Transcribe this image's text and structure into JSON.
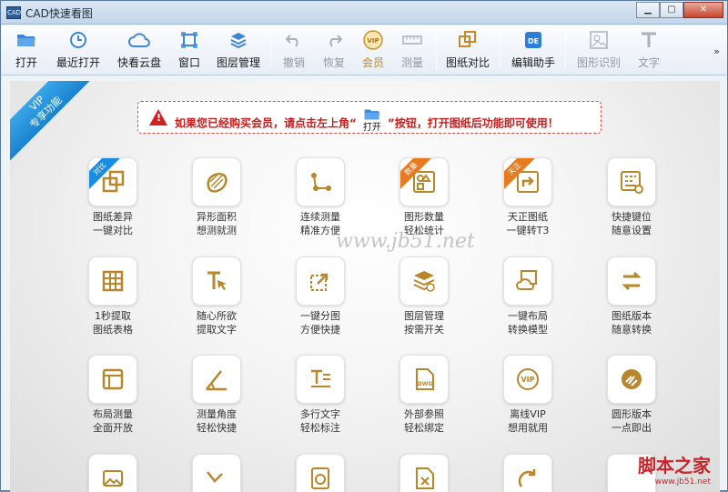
{
  "window": {
    "title": "CAD快速看图",
    "app_icon_text": "CAD",
    "controls": {
      "minimize": "▁",
      "maximize": "▢",
      "close": "✕"
    }
  },
  "toolbar": {
    "items": [
      {
        "label": "打开",
        "icon": "folder-open-icon",
        "enabled": true
      },
      {
        "label": "最近打开",
        "icon": "clock-icon",
        "enabled": true
      },
      {
        "label": "快看云盘",
        "icon": "cloud-icon",
        "enabled": true
      },
      {
        "label": "窗口",
        "icon": "window-icon",
        "enabled": true
      },
      {
        "label": "图层管理",
        "icon": "layers-icon",
        "enabled": true
      },
      {
        "label": "撤销",
        "icon": "undo-icon",
        "enabled": false
      },
      {
        "label": "恢复",
        "icon": "redo-icon",
        "enabled": false
      },
      {
        "label": "会员",
        "icon": "vip-icon",
        "enabled": true
      },
      {
        "label": "测量",
        "icon": "ruler-icon",
        "enabled": false
      },
      {
        "label": "图纸对比",
        "icon": "compare-icon",
        "enabled": true
      },
      {
        "label": "编辑助手",
        "icon": "edit-assistant-icon",
        "enabled": true
      },
      {
        "label": "图形识别",
        "icon": "shape-recognize-icon",
        "enabled": false
      },
      {
        "label": "文字",
        "icon": "text-icon",
        "enabled": false
      }
    ],
    "more": "»"
  },
  "vip_ribbon": {
    "line1": "VIP",
    "line2": "专享功能"
  },
  "notice": {
    "warn_glyph": "!",
    "before": "如果您已经购买会员，请点击左上角“",
    "open_label": "打开",
    "after": "”按钮，打开图纸后功能即可使用！"
  },
  "features": [
    {
      "l1": "图纸差异",
      "l2": "一键对比",
      "icon": "compare-icon",
      "badge": "对比",
      "badge_color": "blue"
    },
    {
      "l1": "异形面积",
      "l2": "想测就测",
      "icon": "irregular-area-icon"
    },
    {
      "l1": "连续测量",
      "l2": "精准方便",
      "icon": "continuous-measure-icon"
    },
    {
      "l1": "图形数量",
      "l2": "轻松统计",
      "icon": "shape-count-icon",
      "badge": "数量",
      "badge_color": "orange"
    },
    {
      "l1": "天正图纸",
      "l2": "一键转T3",
      "icon": "tangent-convert-icon",
      "badge": "天正",
      "badge_color": "orange"
    },
    {
      "l1": "快捷键位",
      "l2": "随意设置",
      "icon": "shortcut-key-icon"
    },
    {
      "l1": "1秒提取",
      "l2": "图纸表格",
      "icon": "table-extract-icon"
    },
    {
      "l1": "随心所欲",
      "l2": "提取文字",
      "icon": "text-extract-icon"
    },
    {
      "l1": "一键分图",
      "l2": "方便快捷",
      "icon": "split-drawing-icon"
    },
    {
      "l1": "图层管理",
      "l2": "按需开关",
      "icon": "layer-toggle-icon"
    },
    {
      "l1": "一键布局",
      "l2": "转换模型",
      "icon": "layout-cloud-icon"
    },
    {
      "l1": "图纸版本",
      "l2": "随意转换",
      "icon": "version-convert-icon"
    },
    {
      "l1": "布局测量",
      "l2": "全面开放",
      "icon": "layout-measure-icon"
    },
    {
      "l1": "测量角度",
      "l2": "轻松快捷",
      "icon": "angle-measure-icon"
    },
    {
      "l1": "多行文字",
      "l2": "轻松标注",
      "icon": "multiline-text-icon"
    },
    {
      "l1": "外部参照",
      "l2": "轻松绑定",
      "icon": "xref-dwg-icon"
    },
    {
      "l1": "离线VIP",
      "l2": "想用就用",
      "icon": "offline-vip-icon"
    },
    {
      "l1": "圆形版本",
      "l2": "一点即出",
      "icon": "round-version-icon"
    },
    {
      "l1": "",
      "l2": "",
      "icon": "image-icon"
    },
    {
      "l1": "",
      "l2": "",
      "icon": "polyline-icon"
    },
    {
      "l1": "",
      "l2": "",
      "icon": "text-a-icon"
    },
    {
      "l1": "",
      "l2": "",
      "icon": "file-x-icon"
    },
    {
      "l1": "",
      "l2": "",
      "icon": "rotate-arrow-icon"
    },
    {
      "l1": "",
      "l2": "",
      "icon": "blank-icon"
    }
  ],
  "watermark": "www.jb51.net",
  "footer": {
    "brand": "脚本之家",
    "url": "www.jb51.net"
  },
  "colors": {
    "accent_gold": "#b8862b",
    "warn_red": "#d32020",
    "vip_blue": "#1a82cf",
    "badge_orange": "#ea7a1f"
  }
}
